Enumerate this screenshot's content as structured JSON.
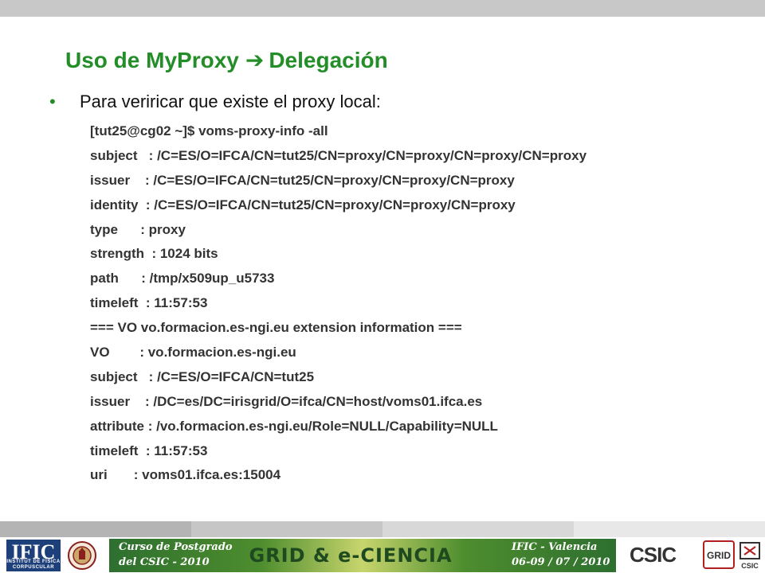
{
  "slide": {
    "title_left": "Uso de MyProxy",
    "title_arrow": "➔",
    "title_right": "Delegación",
    "bullet": "Para veriricar que existe el proxy local:",
    "code_lines": [
      "[tut25@cg02 ~]$ voms-proxy-info -all",
      "subject   : /C=ES/O=IFCA/CN=tut25/CN=proxy/CN=proxy/CN=proxy/CN=proxy",
      "issuer    : /C=ES/O=IFCA/CN=tut25/CN=proxy/CN=proxy/CN=proxy",
      "identity  : /C=ES/O=IFCA/CN=tut25/CN=proxy/CN=proxy/CN=proxy",
      "type      : proxy",
      "strength  : 1024 bits",
      "path      : /tmp/x509up_u5733",
      "timeleft  : 11:57:53",
      "=== VO vo.formacion.es-ngi.eu extension information ===",
      "VO        : vo.formacion.es-ngi.eu",
      "subject   : /C=ES/O=IFCA/CN=tut25",
      "issuer    : /DC=es/DC=irisgrid/O=ifca/CN=host/voms01.ifca.es",
      "attribute : /vo.formacion.es-ngi.eu/Role=NULL/Capability=NULL",
      "timeleft  : 11:57:53",
      "uri       : voms01.ifca.es:15004"
    ]
  },
  "footer": {
    "ific_logo": "IFIC",
    "ific_subtitle": "INSTITUT DE FÍSICA CORPUSCULAR",
    "banner_left_1": "Curso de Postgrado",
    "banner_left_2": "del CSIC - 2010",
    "banner_center": "GRID & e-CIENCIA",
    "banner_right_1": "IFIC - Valencia",
    "banner_right_2": "06-09 / 07 / 2010",
    "csic_logo": "CSIC",
    "grid_logo": "GRID",
    "csic_small": "CSIC"
  },
  "colors": {
    "title": "#238d28",
    "top_bar": "#c8c8c8",
    "bands": [
      "#b4b4b4",
      "#c6c6c6",
      "#d8d8d8",
      "#e8e8e8"
    ]
  }
}
